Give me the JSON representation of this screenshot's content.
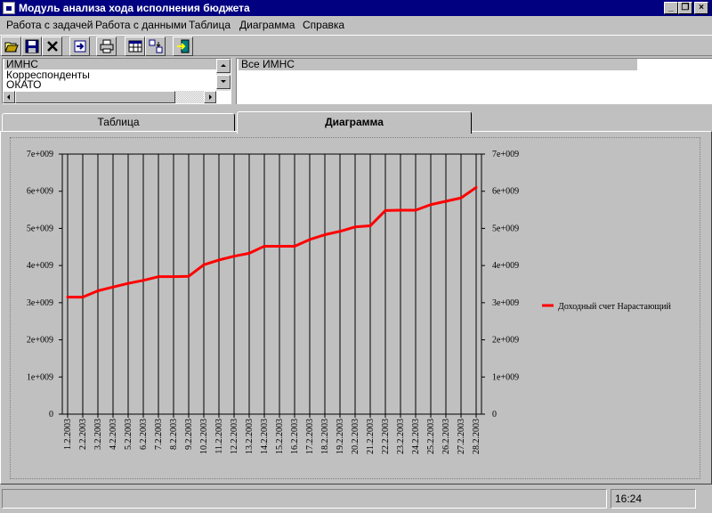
{
  "window": {
    "title": "Модуль анализа хода исполнения бюджета"
  },
  "menu": [
    "Работа с задачей",
    "Работа с данными",
    "Таблица",
    "Диаграмма",
    "Справка"
  ],
  "toolbar": [
    "open-icon",
    "save-icon",
    "delete-icon",
    "import-icon",
    "print-icon",
    "table-icon",
    "sort-icon",
    "exit-icon"
  ],
  "left_list": {
    "items": [
      "ИМНС",
      "Корреспонденты",
      "ОКАТО"
    ]
  },
  "right_list": {
    "items": [
      "Все ИМНС"
    ]
  },
  "tabs": [
    {
      "label": "Таблица",
      "active": false
    },
    {
      "label": "Диаграмма",
      "active": true
    }
  ],
  "colors": {
    "series": "#ff0000",
    "titlebar": "#000080",
    "face": "#c0c0c0"
  },
  "chart_data": {
    "type": "line",
    "ylim": [
      0,
      7000000000
    ],
    "yticks": [
      "0",
      "1e+009",
      "2e+009",
      "3e+009",
      "4e+009",
      "5e+009",
      "6e+009",
      "7e+009"
    ],
    "categories": [
      "1.2.2003",
      "2.2.2003",
      "3.2.2003",
      "4.2.2003",
      "5.2.2003",
      "6.2.2003",
      "7.2.2003",
      "8.2.2003",
      "9.2.2003",
      "10.2.2003",
      "11.2.2003",
      "12.2.2003",
      "13.2.2003",
      "14.2.2003",
      "15.2.2003",
      "16.2.2003",
      "17.2.2003",
      "18.2.2003",
      "19.2.2003",
      "20.2.2003",
      "21.2.2003",
      "22.2.2003",
      "23.2.2003",
      "24.2.2003",
      "25.2.2003",
      "26.2.2003",
      "27.2.2003",
      "28.2.2003"
    ],
    "series": [
      {
        "name": "Доходный счет Нарастающий",
        "values": [
          3150000000,
          3150000000,
          3320000000,
          3420000000,
          3520000000,
          3600000000,
          3700000000,
          3700000000,
          3710000000,
          4020000000,
          4150000000,
          4250000000,
          4330000000,
          4520000000,
          4520000000,
          4520000000,
          4700000000,
          4830000000,
          4920000000,
          5040000000,
          5070000000,
          5480000000,
          5490000000,
          5490000000,
          5640000000,
          5730000000,
          5820000000,
          6100000000
        ]
      }
    ],
    "grid": true,
    "legend": "right"
  },
  "status": {
    "left": "",
    "time": "16:24"
  }
}
